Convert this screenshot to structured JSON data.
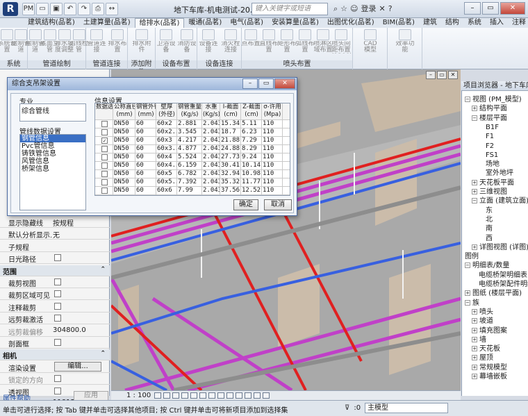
{
  "app": {
    "title": "地下车库-机电测试-20...",
    "search_placeholder": "键入关键字或短语",
    "login_label": "登录",
    "help_label": "?"
  },
  "ribbon_tabs": [
    "建筑结构(品茗)",
    "土建算量(品茗)",
    "给排水(品茗)",
    "暖通(品茗)",
    "电气(品茗)",
    "安装算量(品茗)",
    "出图优化(品茗)",
    "BIM(品茗)",
    "建筑",
    "结构",
    "系统",
    "插入",
    "注释",
    "分析"
  ],
  "ribbon": {
    "groups": [
      {
        "label": "系统",
        "buttons": [
          "系统设置",
          "绘制管道"
        ]
      },
      {
        "label": "管道绘制",
        "buttons": [
          "绘制管道",
          "底面立管",
          "排水坡度调整",
          "沿线检管"
        ]
      },
      {
        "label": "管道连接",
        "buttons": [
          "管道连接",
          "排水布置"
        ]
      },
      {
        "label": "添加附件",
        "buttons": [
          "排水附件"
        ]
      },
      {
        "label": "设备布置",
        "buttons": [
          "卫浴设备",
          "消防设备"
        ]
      },
      {
        "label": "设备连接",
        "buttons": [
          "设备连接",
          "消火栓连接"
        ]
      },
      {
        "label": "喷头布置",
        "buttons": [
          "点布置",
          "直线布置",
          "矩形布置",
          "弧线布置",
          "喷淋区域布置",
          "喷头间距布置(1200)"
        ]
      },
      {
        "label": "",
        "buttons": [
          "CAD模型"
        ]
      },
      {
        "label": "",
        "buttons": [
          "效率功能"
        ]
      }
    ]
  },
  "dialog": {
    "title": "综合支吊架设置",
    "spec_label": "专业",
    "spec_value": "综合管线",
    "pipe_data_label": "管线数据设置",
    "pipe_types": [
      "钢管信息",
      "Pvc管信息",
      "铸铁管信息",
      "风管信息",
      "桥架信息"
    ],
    "info_label": "信息设置",
    "table_headers": [
      "数据选",
      "公称直径\n(mm)",
      "钢管外径\n(mm)",
      "壁厚\n(外径)",
      "钢管重量\n(Kg/s)",
      "水重\n(Kg/s)",
      "I-截面\n(cm)",
      "Z-截面\n(cm)",
      "σ-许用\n(Mpa)"
    ],
    "table_rows": [
      {
        "checked": false,
        "dn": "DN50",
        "od": "60",
        "wall": "60x2",
        "steel_wt": "2.881",
        "water_wt": "2.043",
        "i_sec": "15.34",
        "z_sec": "5.11",
        "sigma": "110"
      },
      {
        "checked": false,
        "dn": "DN50",
        "od": "60",
        "wall": "60x2.5",
        "steel_wt": "3.545",
        "water_wt": "2.043",
        "i_sec": "18.7",
        "z_sec": "6.23",
        "sigma": "110"
      },
      {
        "checked": true,
        "dn": "DN50",
        "od": "60",
        "wall": "60x3",
        "steel_wt": "4.217",
        "water_wt": "2.043",
        "i_sec": "21.88",
        "z_sec": "7.29",
        "sigma": "110"
      },
      {
        "checked": false,
        "dn": "DN50",
        "od": "60",
        "wall": "60x3.5",
        "steel_wt": "4.877",
        "water_wt": "2.043",
        "i_sec": "24.88",
        "z_sec": "8.29",
        "sigma": "110"
      },
      {
        "checked": false,
        "dn": "DN50",
        "od": "60",
        "wall": "60x4",
        "steel_wt": "5.524",
        "water_wt": "2.043",
        "i_sec": "27.73",
        "z_sec": "9.24",
        "sigma": "110"
      },
      {
        "checked": false,
        "dn": "DN50",
        "od": "60",
        "wall": "60x4.5",
        "steel_wt": "6.159",
        "water_wt": "2.043",
        "i_sec": "30.41",
        "z_sec": "10.14",
        "sigma": "110"
      },
      {
        "checked": false,
        "dn": "DN50",
        "od": "60",
        "wall": "60x5",
        "steel_wt": "6.782",
        "water_wt": "2.043",
        "i_sec": "32.94",
        "z_sec": "10.98",
        "sigma": "110"
      },
      {
        "checked": false,
        "dn": "DN50",
        "od": "60",
        "wall": "60x5.5",
        "steel_wt": "7.392",
        "water_wt": "2.043",
        "i_sec": "35.32",
        "z_sec": "11.77",
        "sigma": "110"
      },
      {
        "checked": false,
        "dn": "DN50",
        "od": "60",
        "wall": "60x6",
        "steel_wt": "7.99",
        "water_wt": "2.043",
        "i_sec": "37.56",
        "z_sec": "12.52",
        "sigma": "110"
      }
    ],
    "ok_label": "确定",
    "cancel_label": "取消"
  },
  "properties": {
    "rows": [
      {
        "type": "prop",
        "key": "显示隐藏线",
        "value": "按规程"
      },
      {
        "type": "prop",
        "key": "默认分析显示...",
        "value": "无"
      },
      {
        "type": "prop",
        "key": "子规程",
        "value": ""
      },
      {
        "type": "check",
        "key": "日光路径",
        "value": ""
      },
      {
        "type": "section",
        "key": "范围",
        "value": "⌃"
      },
      {
        "type": "check",
        "key": "裁剪视图",
        "value": ""
      },
      {
        "type": "check",
        "key": "裁剪区域可见",
        "value": ""
      },
      {
        "type": "check",
        "key": "注释裁剪",
        "value": ""
      },
      {
        "type": "check",
        "key": "远剪裁激活",
        "value": ""
      },
      {
        "type": "gray",
        "key": "远剪裁偏移",
        "value": "304800.0"
      },
      {
        "type": "check",
        "key": "剖面框",
        "value": ""
      },
      {
        "type": "section",
        "key": "相机",
        "value": "⌃"
      },
      {
        "type": "button",
        "key": "渲染设置",
        "value": "编辑..."
      },
      {
        "type": "grayc",
        "key": "锁定的方向",
        "value": ""
      },
      {
        "type": "check",
        "key": "透视图",
        "value": ""
      },
      {
        "type": "prop",
        "key": "视点高度",
        "value": "118154.3"
      },
      {
        "type": "prop",
        "key": "目标高度",
        "value": "-125727.2"
      },
      {
        "type": "gray",
        "key": "相机位置",
        "value": "调整"
      }
    ],
    "help_link": "属性帮助",
    "apply_label": "应用"
  },
  "browser": {
    "title": "项目浏览器 - 地下车库-机...",
    "nodes": [
      {
        "label": "视图 (PM_模型)",
        "indent": 0,
        "exp": "−"
      },
      {
        "label": "结构平面",
        "indent": 1,
        "exp": "+"
      },
      {
        "label": "楼层平面",
        "indent": 1,
        "exp": "−"
      },
      {
        "label": "B1F",
        "indent": 3,
        "exp": ""
      },
      {
        "label": "F1",
        "indent": 3,
        "exp": ""
      },
      {
        "label": "F2",
        "indent": 3,
        "exp": ""
      },
      {
        "label": "FS1",
        "indent": 3,
        "exp": ""
      },
      {
        "label": "场地",
        "indent": 3,
        "exp": ""
      },
      {
        "label": "室外地坪",
        "indent": 3,
        "exp": ""
      },
      {
        "label": "天花板平面",
        "indent": 1,
        "exp": "+"
      },
      {
        "label": "三维视图",
        "indent": 1,
        "exp": "+"
      },
      {
        "label": "立面 (建筑立面)",
        "indent": 1,
        "exp": "−"
      },
      {
        "label": "东",
        "indent": 3,
        "exp": ""
      },
      {
        "label": "北",
        "indent": 3,
        "exp": ""
      },
      {
        "label": "南",
        "indent": 3,
        "exp": ""
      },
      {
        "label": "西",
        "indent": 3,
        "exp": ""
      },
      {
        "label": "详图视图 (详图)",
        "indent": 1,
        "exp": "+"
      },
      {
        "label": "图例",
        "indent": 0,
        "exp": ""
      },
      {
        "label": "明细表/数量",
        "indent": 0,
        "exp": "−"
      },
      {
        "label": "电缆桥架明细表",
        "indent": 2,
        "exp": ""
      },
      {
        "label": "电缆桥架配件明细",
        "indent": 2,
        "exp": ""
      },
      {
        "label": "图纸 (楼层平面)",
        "indent": 0,
        "exp": "+"
      },
      {
        "label": "族",
        "indent": 0,
        "exp": "−"
      },
      {
        "label": "喷头",
        "indent": 1,
        "exp": "+"
      },
      {
        "label": "坡道",
        "indent": 1,
        "exp": "+"
      },
      {
        "label": "填充图案",
        "indent": 1,
        "exp": "+"
      },
      {
        "label": "墙",
        "indent": 1,
        "exp": "+"
      },
      {
        "label": "天花板",
        "indent": 1,
        "exp": "+"
      },
      {
        "label": "屋顶",
        "indent": 1,
        "exp": "+"
      },
      {
        "label": "常规模型",
        "indent": 1,
        "exp": "+"
      },
      {
        "label": "幕墙嵌板",
        "indent": 1,
        "exp": "+"
      }
    ]
  },
  "viewbar": {
    "scale": "1 : 100"
  },
  "status": {
    "text": "单击可进行选择; 按 Tab 键并单击可选择其他项目; 按 Ctrl 键并单击可将新项目添加到选择集",
    "filter_count": ":0",
    "model_label": "主模型"
  },
  "colors": {
    "pipe_magenta": "#c040c8",
    "pipe_red": "#e02020",
    "pipe_blue": "#3860e0",
    "wall": "#c9b9a6"
  }
}
